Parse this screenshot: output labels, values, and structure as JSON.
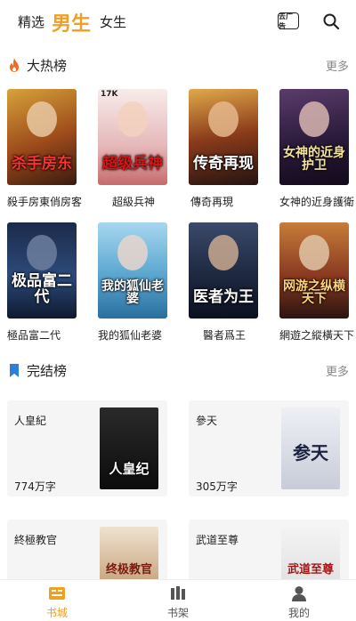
{
  "header": {
    "tabs": [
      {
        "label": "精选",
        "active": false
      },
      {
        "label": "男生",
        "active": true
      },
      {
        "label": "女生",
        "active": false
      }
    ],
    "ad_badge": "去广告",
    "search_icon": "search-icon",
    "accent_color": "#f0a020"
  },
  "hot": {
    "icon": "flame-icon",
    "title": "大热榜",
    "more": "更多",
    "books": [
      {
        "name": "殺手房東俏房客",
        "cover_text": "杀手房东"
      },
      {
        "name": "超級兵神",
        "cover_text": "超级兵神",
        "cover_tag": "17K"
      },
      {
        "name": "傳奇再現",
        "cover_text": "传奇再现"
      },
      {
        "name": "女神的近身護衛",
        "cover_text": "女神的近身护卫"
      },
      {
        "name": "極品富二代",
        "cover_text": "极品富二代"
      },
      {
        "name": "我的狐仙老婆",
        "cover_text": "我的狐仙老婆"
      },
      {
        "name": "醫者爲王",
        "cover_text": "医者为王"
      },
      {
        "name": "網遊之縱橫天下",
        "cover_text": "网游之纵横天下"
      }
    ]
  },
  "finished": {
    "icon": "bookmark-icon",
    "title": "完结榜",
    "more": "更多",
    "books": [
      {
        "name": "人皇紀",
        "words": "774万字",
        "cover_text": "人皇纪"
      },
      {
        "name": "參天",
        "words": "305万字",
        "cover_text": "参天"
      },
      {
        "name": "終極教官",
        "words": "",
        "cover_text": "终极教官"
      },
      {
        "name": "武道至尊",
        "words": "",
        "cover_text": "武道至尊"
      }
    ]
  },
  "bottom_nav": [
    {
      "label": "书城",
      "icon": "bookstore-icon",
      "active": true
    },
    {
      "label": "书架",
      "icon": "bookshelf-icon",
      "active": false
    },
    {
      "label": "我的",
      "icon": "profile-icon",
      "active": false
    }
  ]
}
